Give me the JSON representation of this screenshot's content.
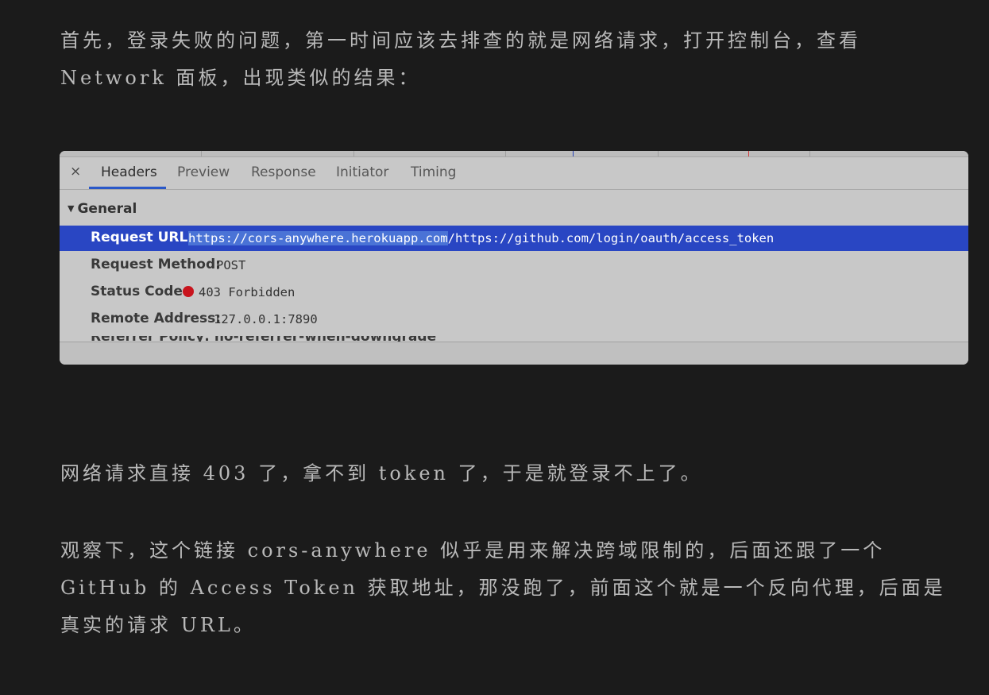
{
  "article": {
    "p1": "首先，登录失败的问题，第一时间应该去排查的就是网络请求，打开控制台，查看 Network 面板，出现类似的结果：",
    "p2": "网络请求直接 403 了，拿不到 token 了，于是就登录不上了。",
    "p3": "观察下，这个链接 cors-anywhere 似乎是用来解决跨域限制的，后面还跟了一个 GitHub 的 Access Token 获取地址，那没跑了，前面这个就是一个反向代理，后面是真实的请求 URL。"
  },
  "devtools": {
    "close_icon": "×",
    "tabs": [
      "Headers",
      "Preview",
      "Response",
      "Initiator",
      "Timing"
    ],
    "active_tab": "Headers",
    "section_title": "General",
    "rows": [
      {
        "key": "Request URL:",
        "value_highlighted": "https://cors-anywhere.herokuapp.com",
        "value_rest": "/https://github.com/login/oauth/access_token"
      },
      {
        "key": "Request Method:",
        "value": "POST"
      },
      {
        "key": "Status Code:",
        "value": "403 Forbidden",
        "status_color": "#c8141d"
      },
      {
        "key": "Remote Address:",
        "value": "127.0.0.1:7890"
      }
    ],
    "cut_row_text": "Referrer Policy: no-referrer-when-downgrade"
  }
}
